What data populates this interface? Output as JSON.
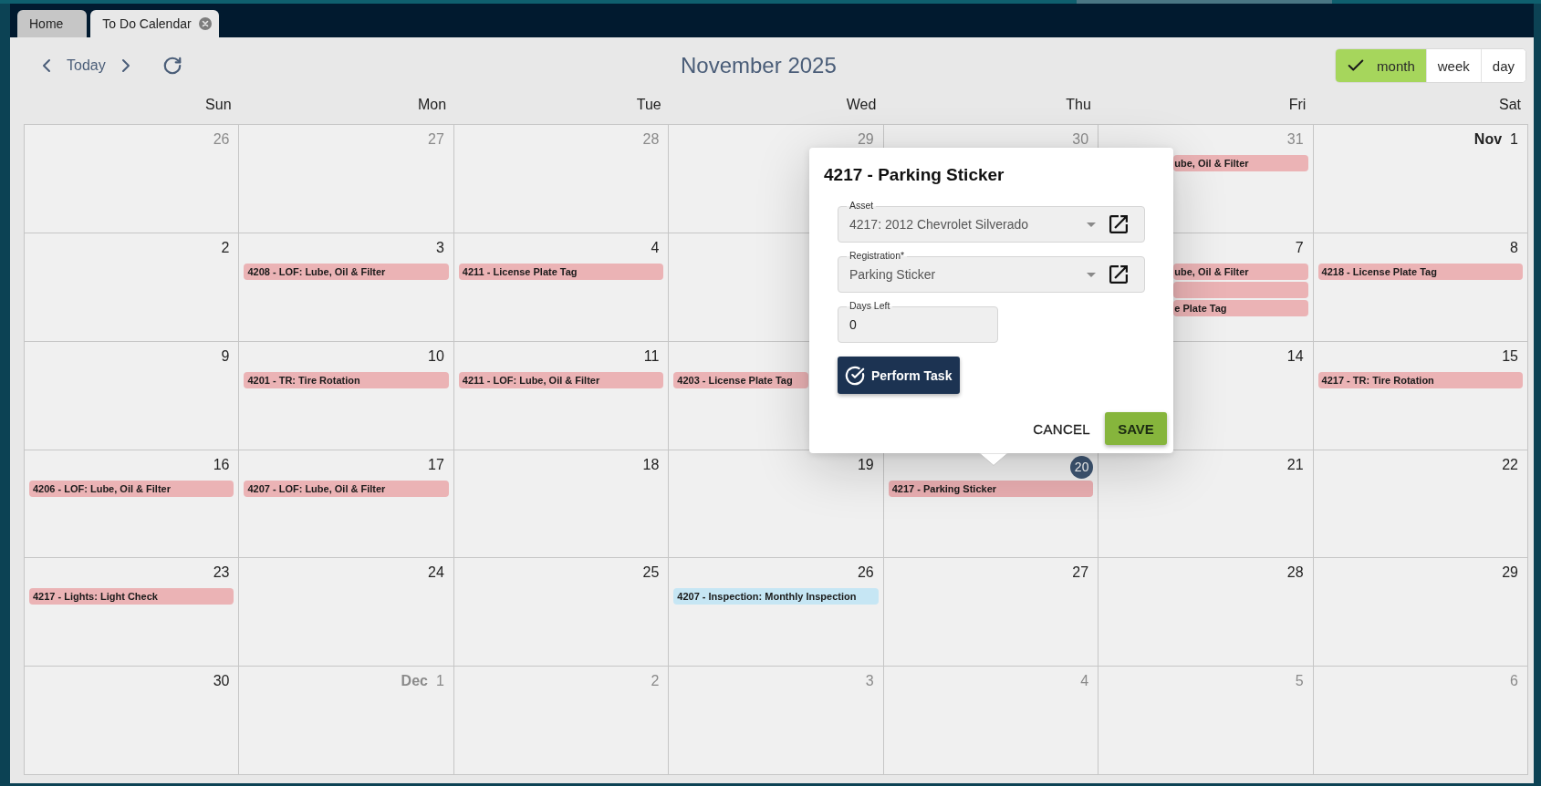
{
  "tabs": [
    {
      "label": "Home",
      "selected": false,
      "closable": false
    },
    {
      "label": "To Do Calendar",
      "selected": true,
      "closable": true
    }
  ],
  "toolbar": {
    "today_label": "Today",
    "title": "November 2025",
    "views": [
      {
        "label": "month",
        "selected": true
      },
      {
        "label": "week",
        "selected": false
      },
      {
        "label": "day",
        "selected": false
      }
    ]
  },
  "calendar": {
    "weekdays": [
      "Sun",
      "Mon",
      "Tue",
      "Wed",
      "Thu",
      "Fri",
      "Sat"
    ],
    "weeks": [
      {
        "sun": {
          "date": "26",
          "kind": "other_month"
        },
        "mon": {
          "date": "27",
          "kind": "other_month"
        },
        "tue": {
          "date": "28",
          "kind": "other_month"
        },
        "wed": {
          "date": "29",
          "kind": "other_month"
        },
        "thu": {
          "date": "30",
          "kind": "other_month"
        },
        "fri": {
          "date": "31",
          "kind": "other_month",
          "events": [
            {
              "title": "ube, Oil & Filter",
              "color": "#ebb3b5"
            }
          ]
        },
        "sat": {
          "month_label": "Nov",
          "date": "1",
          "kind": "this_month"
        }
      },
      {
        "sun": {
          "date": "2",
          "kind": "this_month"
        },
        "mon": {
          "date": "3",
          "kind": "this_month",
          "events": [
            {
              "title": "4208 - LOF: Lube, Oil & Filter",
              "color": "#ebb3b5"
            }
          ]
        },
        "tue": {
          "date": "4",
          "kind": "this_month",
          "events": [
            {
              "title": "4211 - License Plate Tag",
              "color": "#ebb3b5"
            }
          ]
        },
        "fri": {
          "date": "7",
          "kind": "this_month",
          "events": [
            {
              "title": "ube, Oil & Filter",
              "color": "#ebb3b5"
            },
            {
              "color": "#ebb3b5"
            },
            {
              "title": "e Plate Tag",
              "color": "#ebb3b5"
            }
          ]
        },
        "sat": {
          "date": "8",
          "kind": "this_month",
          "events": [
            {
              "title": "4218 - License Plate Tag",
              "color": "#ebb3b5"
            }
          ]
        }
      },
      {
        "sun": {
          "date": "9",
          "kind": "this_month"
        },
        "mon": {
          "date": "10",
          "kind": "this_month",
          "events": [
            {
              "title": "4201 - TR: Tire Rotation",
              "color": "#ebb3b5"
            }
          ]
        },
        "tue": {
          "date": "11",
          "kind": "this_month",
          "events": [
            {
              "title": "4211 - LOF: Lube, Oil & Filter",
              "color": "#ebb3b5"
            }
          ]
        },
        "wed": {
          "events": [
            {
              "title": "4203 - License Plate Tag",
              "color": "#ebb3b5"
            }
          ]
        },
        "fri": {
          "date": "14",
          "kind": "this_month"
        },
        "sat": {
          "date": "15",
          "kind": "this_month",
          "events": [
            {
              "title": "4217 - TR: Tire Rotation",
              "color": "#ebb3b5"
            }
          ]
        }
      },
      {
        "sun": {
          "date": "16",
          "kind": "this_month",
          "events": [
            {
              "title": "4206 - LOF: Lube, Oil & Filter",
              "color": "#ebb3b5"
            }
          ]
        },
        "mon": {
          "date": "17",
          "kind": "this_month",
          "events": [
            {
              "title": "4207 - LOF: Lube, Oil & Filter",
              "color": "#ebb3b5"
            }
          ]
        },
        "tue": {
          "date": "18",
          "kind": "this_month"
        },
        "wed": {
          "date": "19",
          "kind": "this_month"
        },
        "thu": {
          "date": "20",
          "kind": "today",
          "events": [
            {
              "title": "4217 - Parking Sticker",
              "color": "#e9aeb1"
            }
          ]
        },
        "fri": {
          "date": "21",
          "kind": "this_month"
        },
        "sat": {
          "date": "22",
          "kind": "this_month"
        }
      },
      {
        "sun": {
          "date": "23",
          "kind": "this_month",
          "events": [
            {
              "title": "4217 - Lights: Light Check",
              "color": "#ebb3b5"
            }
          ]
        },
        "mon": {
          "date": "24",
          "kind": "this_month"
        },
        "tue": {
          "date": "25",
          "kind": "this_month"
        },
        "wed": {
          "date": "26",
          "kind": "this_month",
          "events": [
            {
              "title": "4207 - Inspection: Monthly Inspection",
              "color": "#c6e6f4"
            }
          ]
        },
        "thu": {
          "date": "27",
          "kind": "this_month"
        },
        "fri": {
          "date": "28",
          "kind": "this_month"
        },
        "sat": {
          "date": "29",
          "kind": "this_month"
        }
      },
      {
        "sun": {
          "date": "30",
          "kind": "this_month"
        },
        "mon": {
          "month_label": "Dec",
          "date": "1",
          "kind": "other_month"
        },
        "tue": {
          "date": "2",
          "kind": "other_month"
        },
        "wed": {
          "date": "3",
          "kind": "other_month"
        },
        "thu": {
          "date": "4",
          "kind": "other_month"
        },
        "fri": {
          "date": "5",
          "kind": "other_month"
        },
        "sat": {
          "date": "6",
          "kind": "other_month"
        }
      }
    ]
  },
  "dialog": {
    "title": "4217 - Parking Sticker",
    "fields": [
      {
        "kind": "select",
        "label": "Asset",
        "value": "4217: 2012 Chevrolet Silverado"
      },
      {
        "kind": "select",
        "label": "Registration*",
        "value": "Parking Sticker"
      },
      {
        "kind": "number",
        "label": "Days Left",
        "value": "0"
      }
    ],
    "action": "Perform Task",
    "buttons": [
      {
        "label": "CANCEL",
        "kind": "text"
      },
      {
        "label": "SAVE",
        "kind": "primary"
      }
    ]
  }
}
